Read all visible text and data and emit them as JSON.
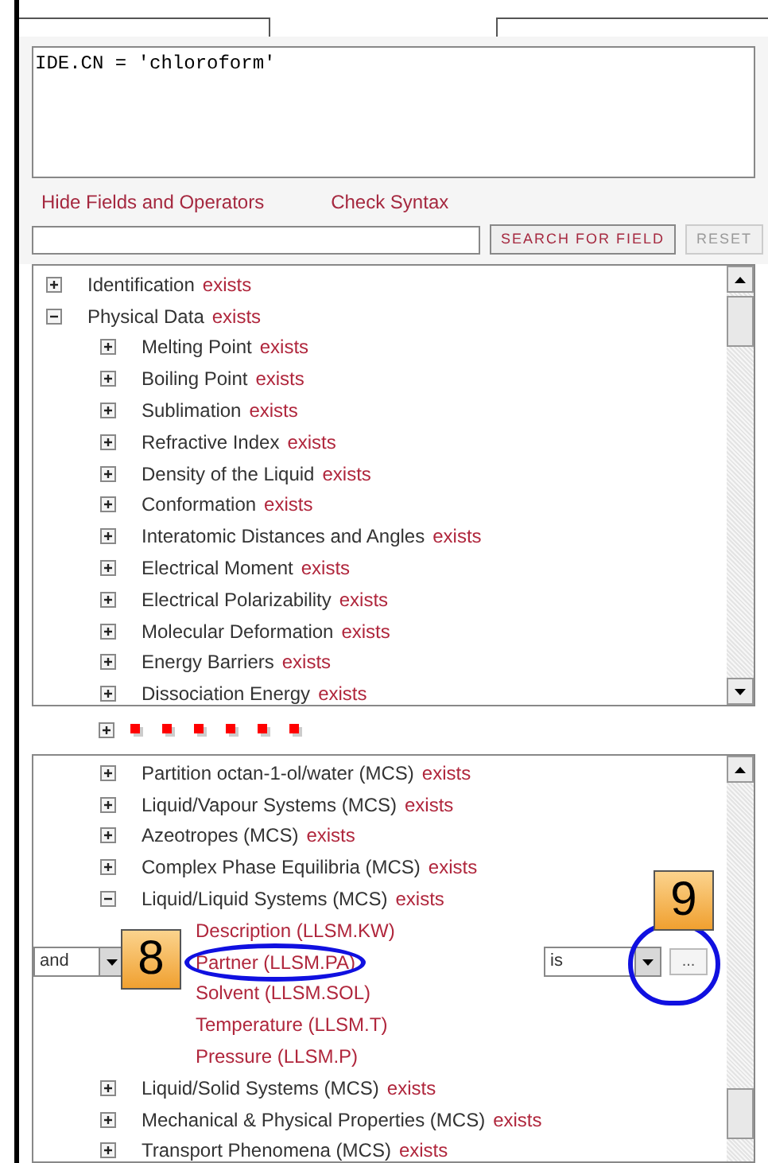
{
  "query": {
    "value": "IDE.CN = 'chloroform'"
  },
  "links": [
    "Hide Fields and Operators",
    "Check Syntax"
  ],
  "field_search": {
    "buttons": [
      {
        "label": "SEARCH FOR FIELD",
        "disabled": false
      },
      {
        "label": "RESET",
        "disabled": true
      }
    ]
  },
  "upper_tree": [
    {
      "label": "Identification",
      "suffix": "exists",
      "expanded": false
    },
    {
      "label": "Physical Data",
      "suffix": "exists",
      "expanded": true,
      "children": [
        {
          "label": "Melting Point",
          "suffix": "exists",
          "expanded": false
        },
        {
          "label": "Boiling Point",
          "suffix": "exists",
          "expanded": false
        },
        {
          "label": "Sublimation",
          "suffix": "exists",
          "expanded": false
        },
        {
          "label": "Refractive Index",
          "suffix": "exists",
          "expanded": false
        },
        {
          "label": "Density of the Liquid",
          "suffix": "exists",
          "expanded": false
        },
        {
          "label": "Conformation",
          "suffix": "exists",
          "expanded": false
        },
        {
          "label": "Interatomic Distances and Angles",
          "suffix": "exists",
          "expanded": false
        },
        {
          "label": "Electrical Moment",
          "suffix": "exists",
          "expanded": false
        },
        {
          "label": "Electrical Polarizability",
          "suffix": "exists",
          "expanded": false
        },
        {
          "label": "Molecular Deformation",
          "suffix": "exists",
          "expanded": false
        },
        {
          "label": "Energy Barriers",
          "suffix": "exists",
          "expanded": false
        },
        {
          "label": "Dissociation Energy",
          "suffix": "exists",
          "expanded": false
        }
      ]
    }
  ],
  "lower_tree": [
    {
      "label": "Partition octan-1-ol/water (MCS)",
      "suffix": "exists",
      "expanded": false
    },
    {
      "label": "Liquid/Vapour Systems (MCS)",
      "suffix": "exists",
      "expanded": false
    },
    {
      "label": "Azeotropes (MCS)",
      "suffix": "exists",
      "expanded": false
    },
    {
      "label": "Complex Phase Equilibria (MCS)",
      "suffix": "exists",
      "expanded": false
    },
    {
      "label": "Liquid/Liquid Systems (MCS)",
      "suffix": "exists",
      "expanded": true,
      "fields": [
        {
          "label": "Description (LLSM.KW)",
          "selected": false
        },
        {
          "label": "Partner (LLSM.PA)",
          "selected": true
        },
        {
          "label": "Solvent (LLSM.SOL)",
          "selected": false
        },
        {
          "label": "Temperature (LLSM.T)",
          "selected": false
        },
        {
          "label": "Pressure (LLSM.P)",
          "selected": false
        }
      ]
    },
    {
      "label": "Liquid/Solid Systems (MCS)",
      "suffix": "exists",
      "expanded": false
    },
    {
      "label": "Mechanical & Physical Properties (MCS)",
      "suffix": "exists",
      "expanded": false
    },
    {
      "label": "Transport Phenomena (MCS)",
      "suffix": "exists",
      "expanded": false
    }
  ],
  "operator_row": {
    "connector": "and",
    "operator": "is",
    "button": "..."
  },
  "callouts": [
    "8",
    "9"
  ]
}
